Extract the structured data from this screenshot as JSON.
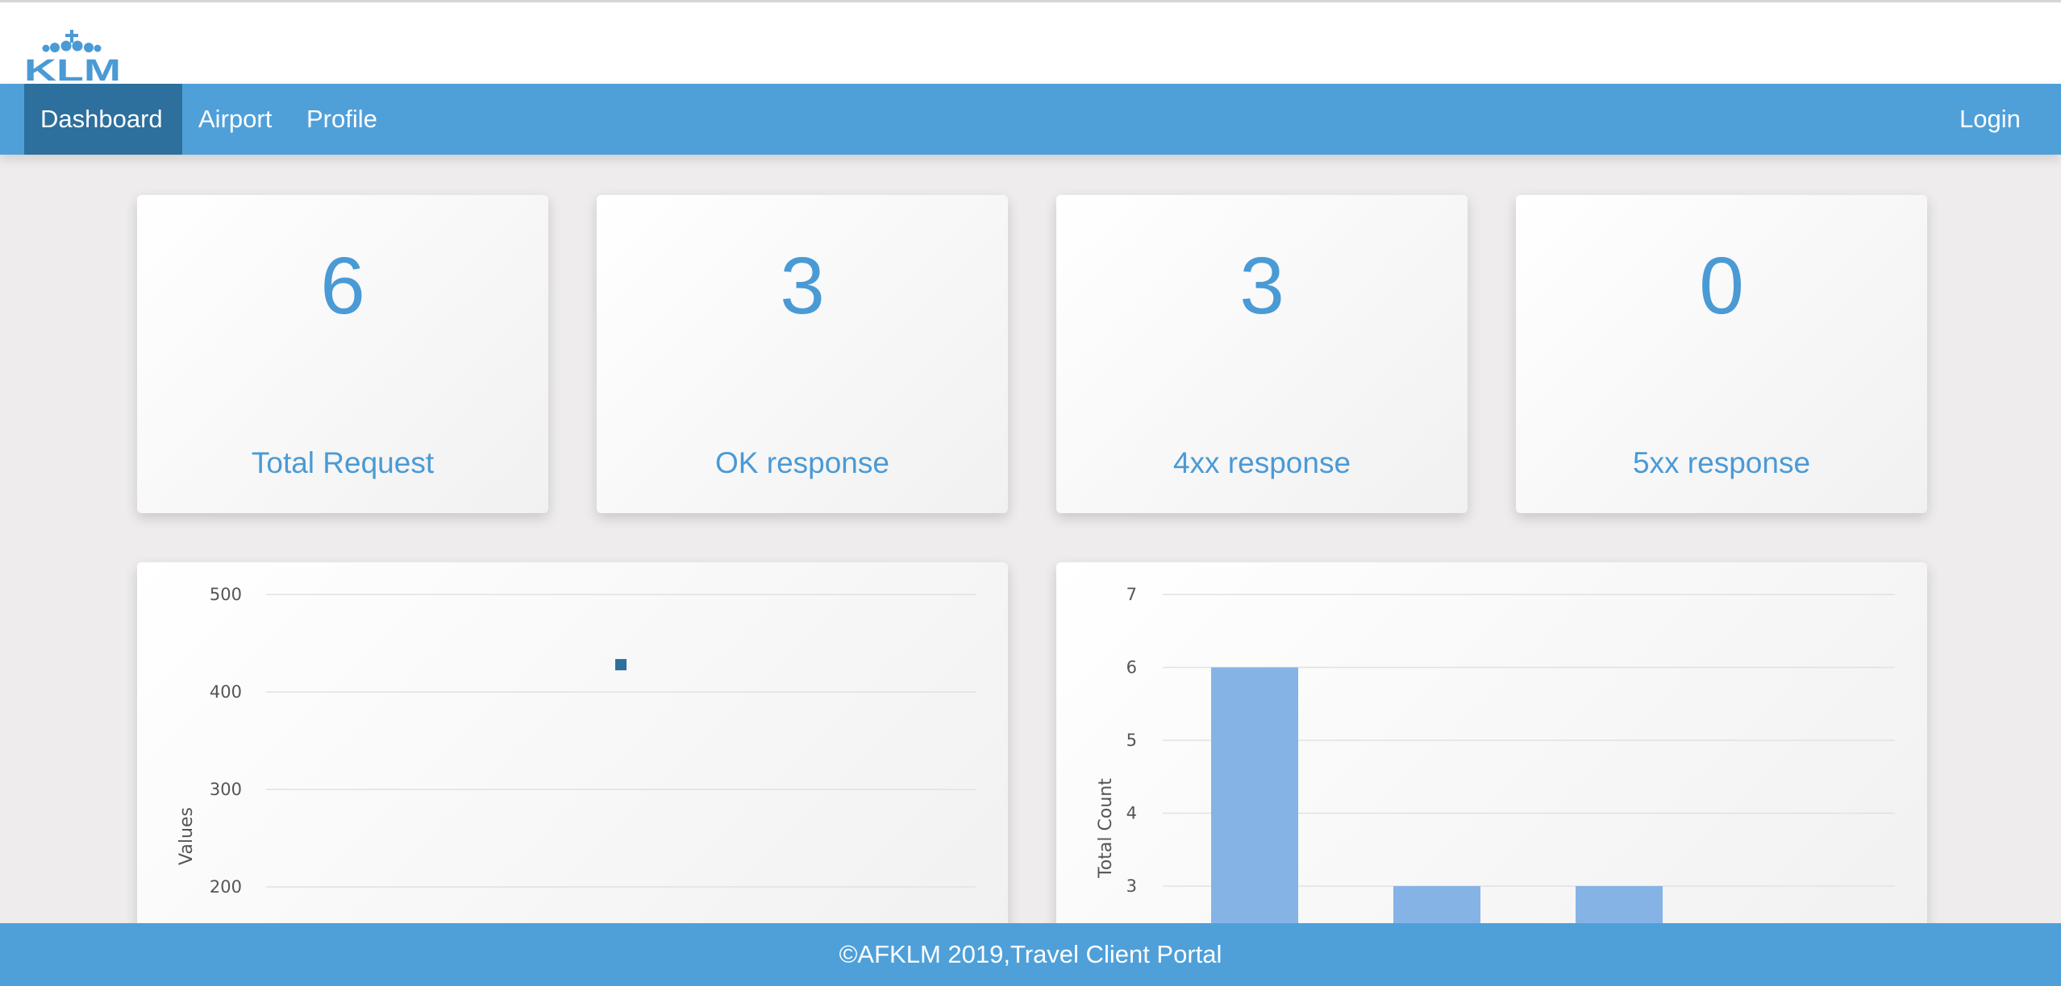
{
  "brand": {
    "logo_text": "KLM"
  },
  "nav": {
    "items": [
      {
        "label": "Dashboard",
        "active": true
      },
      {
        "label": "Airport",
        "active": false
      },
      {
        "label": "Profile",
        "active": false
      }
    ],
    "login_label": "Login"
  },
  "stats": [
    {
      "value": "6",
      "label": "Total Request"
    },
    {
      "value": "3",
      "label": "OK response"
    },
    {
      "value": "3",
      "label": "4xx response"
    },
    {
      "value": "0",
      "label": "5xx response"
    }
  ],
  "chart_data": [
    {
      "type": "scatter",
      "ylabel": "Values",
      "yticks": [
        200,
        300,
        400,
        500
      ],
      "ylim": [
        200,
        500
      ],
      "points": [
        {
          "y": 428
        }
      ],
      "grid": true,
      "color": "#2d6f9d"
    },
    {
      "type": "bar",
      "ylabel": "Total Count",
      "yticks": [
        3,
        4,
        5,
        6,
        7
      ],
      "ylim": [
        3,
        7
      ],
      "values": [
        6,
        3,
        3
      ],
      "grid": true,
      "color": "#85b3e6"
    }
  ],
  "footer": {
    "text": "©AFKLM 2019,Travel Client Portal"
  },
  "colors": {
    "primary": "#4fa0d9",
    "nav_active": "#2d6f9d",
    "stat_text": "#4a9ad5",
    "background": "#eeecec"
  }
}
